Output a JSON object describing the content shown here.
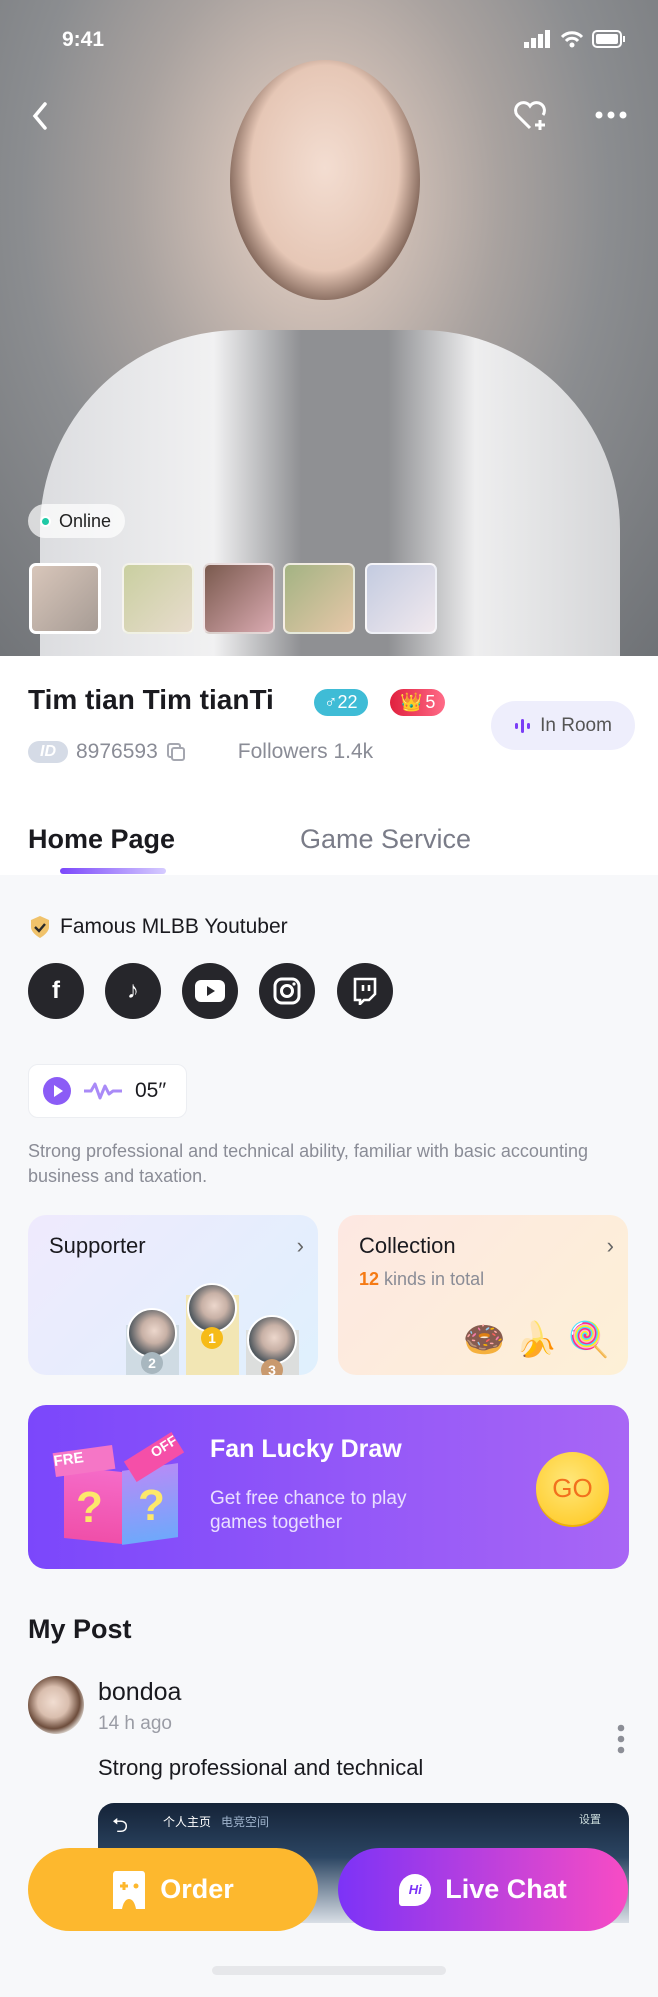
{
  "status_bar": {
    "time": "9:41"
  },
  "hero": {
    "online_label": "Online",
    "photo_count": 5,
    "selected_photo": 0
  },
  "profile": {
    "name": "Tim tian Tim tianTi",
    "gender_badge": "♂22",
    "gender_color": "#3fbcd6",
    "level_badge": "5",
    "level_color": "#f24a6a",
    "id_tag": "ID",
    "id": "8976593",
    "followers": "Followers 1.4k",
    "in_room": "In Room"
  },
  "tabs": [
    {
      "label": "Home Page",
      "active": true
    },
    {
      "label": "Game Service",
      "active": false
    }
  ],
  "home": {
    "title": "Famous MLBB Youtuber",
    "social": [
      "facebook",
      "tiktok",
      "youtube",
      "instagram",
      "twitch"
    ],
    "voice_duration": "05′′",
    "description": "Strong professional and technical ability, familiar with basic accounting business and taxation.",
    "supporter": {
      "title": "Supporter",
      "ranks": [
        "2",
        "1",
        "3"
      ]
    },
    "collection": {
      "title": "Collection",
      "count": "12",
      "count_suffix": " kinds in total"
    },
    "lucky_draw": {
      "title": "Fan Lucky Draw",
      "subtitle": "Get free chance to play games together",
      "go": "GO",
      "box_text_1": "FRE",
      "box_text_2": "OFF"
    }
  },
  "posts": {
    "title": "My Post",
    "items": [
      {
        "user": "bondoa",
        "time": "14 h ago",
        "text": "Strong professional and technical",
        "image_tabs": [
          "个人主页",
          "电竞空间",
          "设置"
        ]
      }
    ]
  },
  "actions": {
    "order": "Order",
    "live_chat": "Live Chat",
    "chat_icon_text": "Hi"
  },
  "accent": "#7b47fb"
}
